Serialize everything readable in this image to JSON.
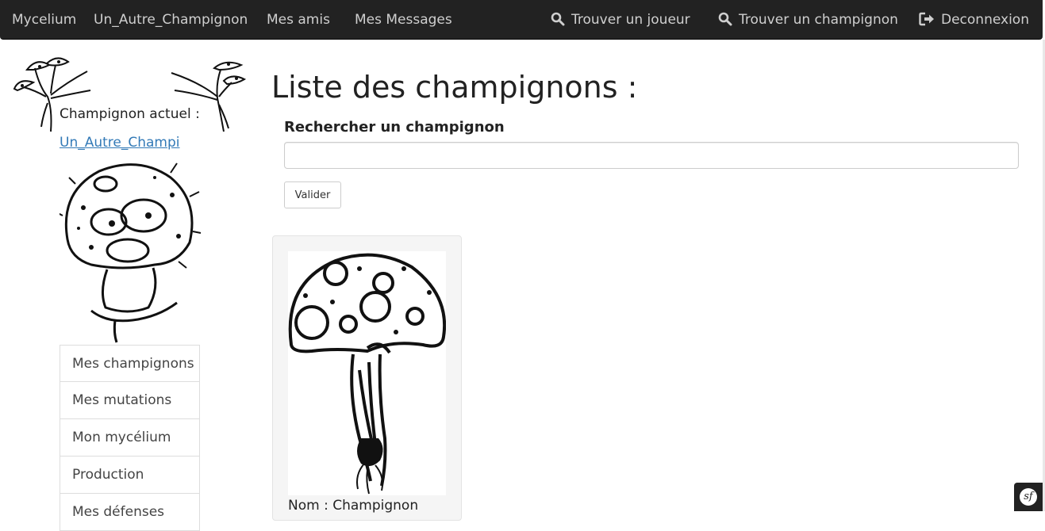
{
  "navbar": {
    "brand": "Mycelium",
    "current_mushroom": "Un_Autre_Champignon",
    "friends": "Mes amis",
    "messages": "Mes Messages",
    "find_player": "Trouver un joueur",
    "find_mushroom": "Trouver un champignon",
    "logout": "Deconnexion"
  },
  "sidebar": {
    "current_label": "Champignon actuel :",
    "current_link": "Un_Autre_Champi",
    "menu": [
      {
        "label": "Mes champignons"
      },
      {
        "label": "Mes mutations"
      },
      {
        "label": "Mon mycélium"
      },
      {
        "label": "Production"
      },
      {
        "label": "Mes défenses"
      }
    ]
  },
  "main": {
    "title": "Liste des champignons :",
    "search_label": "Rechercher un champignon",
    "search_value": "",
    "submit_label": "Valider",
    "cards": [
      {
        "name": "Nom : Champignon"
      }
    ]
  },
  "debug": {
    "badge_letter": "sf"
  },
  "icons": {
    "search": "search-icon",
    "logout": "logout-icon"
  }
}
